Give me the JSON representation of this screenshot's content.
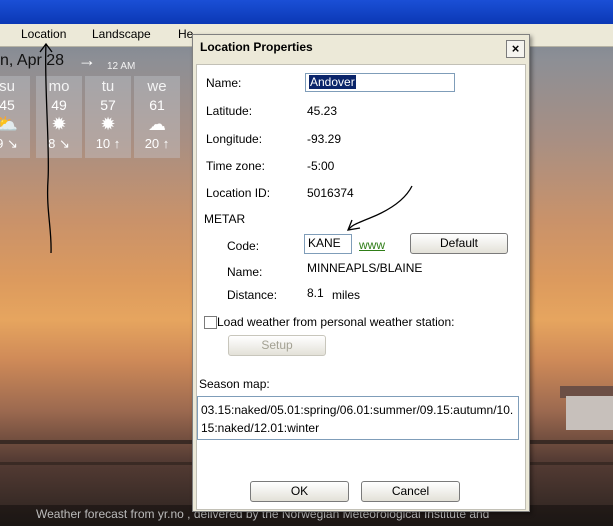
{
  "menu": {
    "location": "Location",
    "landscape": "Landscape",
    "help_partial": "He"
  },
  "background": {
    "date_label": "n, Apr 28",
    "time_label": "12 AM",
    "forecast": [
      {
        "day": "su",
        "temp": "45",
        "icon": "partly-cloudy-icon",
        "wind": "9 ↘"
      },
      {
        "day": "mo",
        "temp": "49",
        "icon": "sun-icon",
        "wind": "8 ↘"
      },
      {
        "day": "tu",
        "temp": "57",
        "icon": "sun-icon",
        "wind": "10 ↑"
      },
      {
        "day": "we",
        "temp": "61",
        "icon": "cloud-icon",
        "wind": "20 ↑"
      }
    ],
    "footer_text": "Weather forecast from  yr.no , delivered by the Norwegian Meteorological Institute and"
  },
  "dialog": {
    "title": "Location Properties",
    "close_label": "×",
    "name_label": "Name:",
    "name_value": "Andover",
    "latitude_label": "Latitude:",
    "latitude_value": "45.23",
    "longitude_label": "Longitude:",
    "longitude_value": "-93.29",
    "timezone_label": "Time zone:",
    "timezone_value": "-5:00",
    "locationid_label": "Location ID:",
    "locationid_value": "5016374",
    "metar_label": "METAR",
    "code_label": "Code:",
    "code_value": "KANE",
    "www_label": "www",
    "default_label": "Default",
    "station_name_label": "Name:",
    "station_name_value": "MINNEAPLS/BLAINE",
    "distance_label": "Distance:",
    "distance_value": "8.1",
    "distance_unit": "miles",
    "pws_label": "Load weather from personal weather station:",
    "setup_label": "Setup",
    "season_label": "Season map:",
    "season_value": "03.15:naked/05.01:spring/06.01:summer/09.15:autumn/10.15:naked/12.01:winter",
    "ok_label": "OK",
    "cancel_label": "Cancel"
  }
}
